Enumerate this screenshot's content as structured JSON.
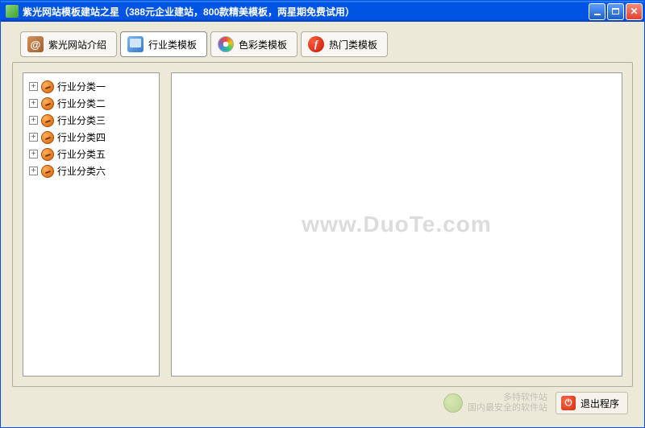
{
  "window": {
    "title": "紫光网站模板建站之星（388元企业建站，800款精美模板，两星期免费试用）"
  },
  "tabs": [
    {
      "label": "紫光网站介绍",
      "icon": "at"
    },
    {
      "label": "行业类模板",
      "icon": "monitor",
      "active": true
    },
    {
      "label": "色彩类模板",
      "icon": "palette"
    },
    {
      "label": "热门类模板",
      "icon": "flash"
    }
  ],
  "tree": {
    "items": [
      {
        "label": "行业分类一"
      },
      {
        "label": "行业分类二"
      },
      {
        "label": "行业分类三"
      },
      {
        "label": "行业分类四"
      },
      {
        "label": "行业分类五"
      },
      {
        "label": "行业分类六"
      }
    ]
  },
  "preview": {
    "watermark": "www.DuoTe.com"
  },
  "footer": {
    "site_name": "多特软件站",
    "site_tag": "国内最安全的软件站",
    "exit_label": "退出程序"
  }
}
